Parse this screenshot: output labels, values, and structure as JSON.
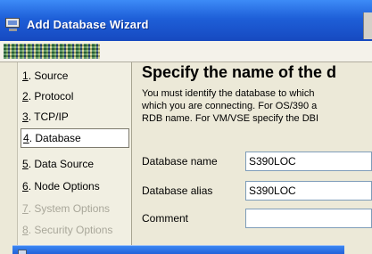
{
  "window": {
    "title": "Add Database Wizard"
  },
  "nav": {
    "items": [
      {
        "num": "1",
        "label": ". Source",
        "state": "normal"
      },
      {
        "num": "2",
        "label": ". Protocol",
        "state": "normal"
      },
      {
        "num": "3",
        "label": ". TCP/IP",
        "state": "normal"
      },
      {
        "num": "4",
        "label": ". Database",
        "state": "selected"
      },
      {
        "num": "5",
        "label": ". Data Source",
        "state": "normal"
      },
      {
        "num": "6",
        "label": ". Node Options",
        "state": "normal"
      },
      {
        "num": "7",
        "label": ". System Options",
        "state": "disabled"
      },
      {
        "num": "8",
        "label": ". Security Options",
        "state": "disabled"
      }
    ]
  },
  "main": {
    "heading": "Specify the name of the d",
    "description": [
      "You must identify the database to which",
      "which you are connecting. For OS/390 a",
      "RDB name. For VM/VSE  specify the DBI"
    ],
    "fields": {
      "database_name": {
        "label": "Database name",
        "value": "S390LOC"
      },
      "database_alias": {
        "label": "Database alias",
        "value": "S390LOC"
      },
      "comment": {
        "label": "Comment",
        "value": ""
      }
    }
  },
  "colors": {
    "titlebar": "#1e5fd8",
    "selected_item_bg": "#ffffff",
    "disabled_text": "#a9a79a"
  }
}
